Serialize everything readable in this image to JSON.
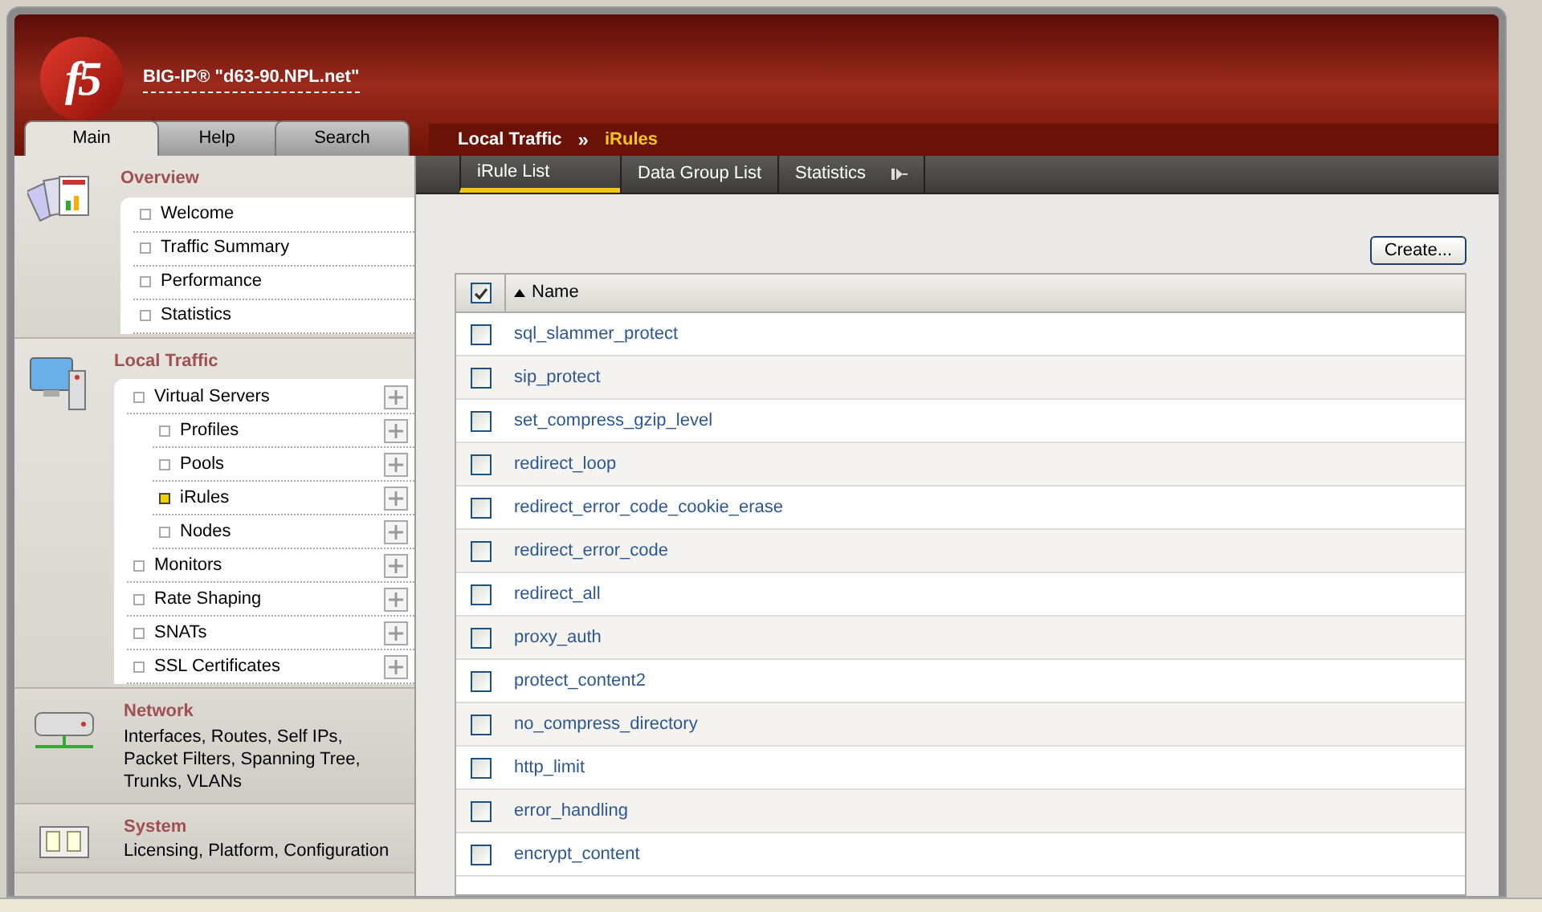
{
  "header": {
    "logo": "f5",
    "title": "BIG-IP® \"d63-90.NPL.net\""
  },
  "tabs": [
    {
      "label": "Main",
      "selected": true
    },
    {
      "label": "Help",
      "selected": false
    },
    {
      "label": "Search",
      "selected": false
    }
  ],
  "breadcrumb": {
    "section": "Local Traffic",
    "separator": "»",
    "page": "iRules"
  },
  "subtabs": [
    {
      "label": "iRule List",
      "selected": true,
      "more": false
    },
    {
      "label": "Data Group List",
      "selected": false,
      "more": false
    },
    {
      "label": "Statistics",
      "selected": false,
      "more": true
    }
  ],
  "sidebar": [
    {
      "kind": "menu",
      "title": "Overview",
      "items": [
        {
          "label": "Welcome",
          "selected": false,
          "addable": false
        },
        {
          "label": "Traffic Summary",
          "selected": false,
          "addable": false
        },
        {
          "label": "Performance",
          "selected": false,
          "addable": false
        },
        {
          "label": "Statistics",
          "selected": false,
          "addable": false
        }
      ]
    },
    {
      "kind": "menu",
      "title": "Local Traffic",
      "items": [
        {
          "label": "Virtual Servers",
          "selected": false,
          "addable": true,
          "children": [
            {
              "label": "Profiles",
              "selected": false,
              "addable": true
            },
            {
              "label": "Pools",
              "selected": false,
              "addable": true
            },
            {
              "label": "iRules",
              "selected": true,
              "addable": true
            },
            {
              "label": "Nodes",
              "selected": false,
              "addable": true
            }
          ]
        },
        {
          "label": "Monitors",
          "selected": false,
          "addable": true
        },
        {
          "label": "Rate Shaping",
          "selected": false,
          "addable": true
        },
        {
          "label": "SNATs",
          "selected": false,
          "addable": true
        },
        {
          "label": "SSL Certificates",
          "selected": false,
          "addable": true
        }
      ]
    },
    {
      "kind": "network",
      "title": "Network",
      "description": "Interfaces, Routes, Self IPs, Packet Filters, Spanning Tree, Trunks, VLANs"
    },
    {
      "kind": "system",
      "title": "System",
      "description": "Licensing, Platform, Configuration"
    }
  ],
  "create_button": "Create...",
  "table": {
    "select_all_checked": true,
    "column": "Name",
    "rows": [
      {
        "name": "sql_slammer_protect",
        "checked": false
      },
      {
        "name": "sip_protect",
        "checked": false
      },
      {
        "name": "set_compress_gzip_level",
        "checked": false
      },
      {
        "name": "redirect_loop",
        "checked": false
      },
      {
        "name": "redirect_error_code_cookie_erase",
        "checked": false
      },
      {
        "name": "redirect_error_code",
        "checked": false
      },
      {
        "name": "redirect_all",
        "checked": false
      },
      {
        "name": "proxy_auth",
        "checked": false
      },
      {
        "name": "protect_content2",
        "checked": false
      },
      {
        "name": "no_compress_directory",
        "checked": false
      },
      {
        "name": "http_limit",
        "checked": false
      },
      {
        "name": "error_handling",
        "checked": false
      },
      {
        "name": "encrypt_content",
        "checked": false
      }
    ]
  }
}
